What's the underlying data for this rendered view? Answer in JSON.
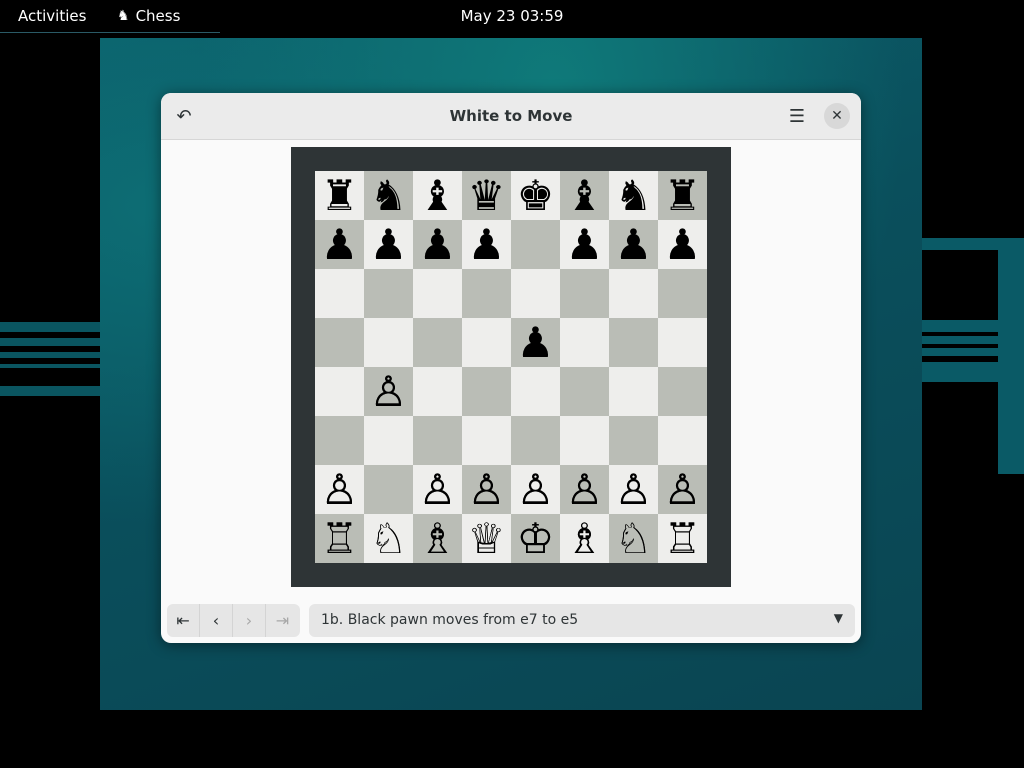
{
  "topbar": {
    "activities": "Activities",
    "app_name": "Chess",
    "app_icon": "chess-knight-icon",
    "clock": "May 23  03:59"
  },
  "window": {
    "title": "White to Move",
    "undo_icon": "undo-icon",
    "menu_icon": "hamburger-menu-icon",
    "close_icon": "close-icon"
  },
  "board": {
    "light_color": "#eeeeec",
    "dark_color": "#babdb6",
    "frame_color": "#2e3436",
    "ranks": [
      [
        "bR",
        "bN",
        "bB",
        "bQ",
        "bK",
        "bB",
        "bN",
        "bR"
      ],
      [
        "bP",
        "bP",
        "bP",
        "bP",
        "",
        "bP",
        "bP",
        "bP"
      ],
      [
        "",
        "",
        "",
        "",
        "",
        "",
        "",
        ""
      ],
      [
        "",
        "",
        "",
        "",
        "bP",
        "",
        "",
        ""
      ],
      [
        "",
        "wP",
        "",
        "",
        "",
        "",
        "",
        ""
      ],
      [
        "",
        "",
        "",
        "",
        "",
        "",
        "",
        ""
      ],
      [
        "wP",
        "",
        "wP",
        "wP",
        "wP",
        "wP",
        "wP",
        "wP"
      ],
      [
        "wR",
        "wN",
        "wB",
        "wQ",
        "wK",
        "wB",
        "wN",
        "wR"
      ]
    ]
  },
  "history": {
    "nav": [
      {
        "name": "first-move-button",
        "glyph": "⇤",
        "enabled": true
      },
      {
        "name": "previous-move-button",
        "glyph": "‹",
        "enabled": true
      },
      {
        "name": "next-move-button",
        "glyph": "›",
        "enabled": false
      },
      {
        "name": "last-move-button",
        "glyph": "⇥",
        "enabled": false
      }
    ],
    "selected": "1b. Black pawn moves from e7 to e5",
    "dropdown_icon": "chevron-down-icon"
  }
}
